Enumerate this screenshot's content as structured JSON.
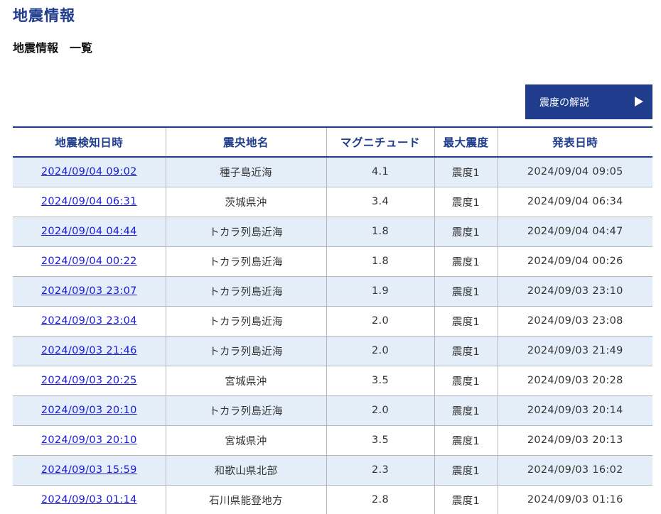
{
  "header": {
    "title": "地震情報",
    "subtitle": "地震情報　一覧"
  },
  "explain_button": {
    "label": "震度の解説",
    "icon": "play-triangle-icon"
  },
  "colors": {
    "brand": "#1f3d8c",
    "row_alt": "#e4eef8",
    "link": "#1a1ad6"
  },
  "table": {
    "columns": [
      "地震検知日時",
      "震央地名",
      "マグニチュード",
      "最大震度",
      "発表日時"
    ],
    "rows": [
      {
        "detected": "2024/09/04 09:02",
        "epicenter": "種子島近海",
        "magnitude": "4.1",
        "intensity": "震度1",
        "announced": "2024/09/04 09:05"
      },
      {
        "detected": "2024/09/04 06:31",
        "epicenter": "茨城県沖",
        "magnitude": "3.4",
        "intensity": "震度1",
        "announced": "2024/09/04 06:34"
      },
      {
        "detected": "2024/09/04 04:44",
        "epicenter": "トカラ列島近海",
        "magnitude": "1.8",
        "intensity": "震度1",
        "announced": "2024/09/04 04:47"
      },
      {
        "detected": "2024/09/04 00:22",
        "epicenter": "トカラ列島近海",
        "magnitude": "1.8",
        "intensity": "震度1",
        "announced": "2024/09/04 00:26"
      },
      {
        "detected": "2024/09/03 23:07",
        "epicenter": "トカラ列島近海",
        "magnitude": "1.9",
        "intensity": "震度1",
        "announced": "2024/09/03 23:10"
      },
      {
        "detected": "2024/09/03 23:04",
        "epicenter": "トカラ列島近海",
        "magnitude": "2.0",
        "intensity": "震度1",
        "announced": "2024/09/03 23:08"
      },
      {
        "detected": "2024/09/03 21:46",
        "epicenter": "トカラ列島近海",
        "magnitude": "2.0",
        "intensity": "震度1",
        "announced": "2024/09/03 21:49"
      },
      {
        "detected": "2024/09/03 20:25",
        "epicenter": "宮城県沖",
        "magnitude": "3.5",
        "intensity": "震度1",
        "announced": "2024/09/03 20:28"
      },
      {
        "detected": "2024/09/03 20:10",
        "epicenter": "トカラ列島近海",
        "magnitude": "2.0",
        "intensity": "震度1",
        "announced": "2024/09/03 20:14"
      },
      {
        "detected": "2024/09/03 20:10",
        "epicenter": "宮城県沖",
        "magnitude": "3.5",
        "intensity": "震度1",
        "announced": "2024/09/03 20:13"
      },
      {
        "detected": "2024/09/03 15:59",
        "epicenter": "和歌山県北部",
        "magnitude": "2.3",
        "intensity": "震度1",
        "announced": "2024/09/03 16:02"
      },
      {
        "detected": "2024/09/03 01:14",
        "epicenter": "石川県能登地方",
        "magnitude": "2.8",
        "intensity": "震度1",
        "announced": "2024/09/03 01:16"
      }
    ]
  }
}
